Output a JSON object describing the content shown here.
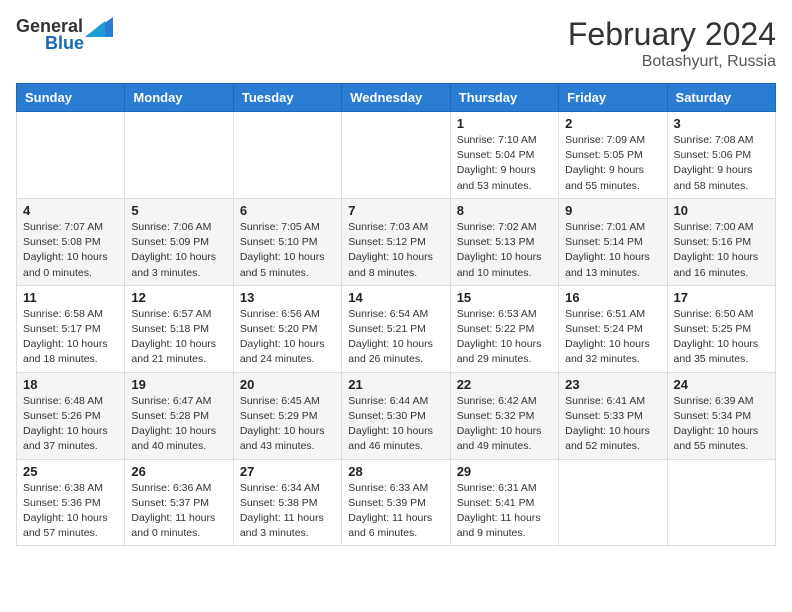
{
  "header": {
    "logo": {
      "general": "General",
      "blue": "Blue"
    },
    "title": "February 2024",
    "location": "Botashyurt, Russia"
  },
  "days_of_week": [
    "Sunday",
    "Monday",
    "Tuesday",
    "Wednesday",
    "Thursday",
    "Friday",
    "Saturday"
  ],
  "weeks": [
    [
      {
        "day": "",
        "info": ""
      },
      {
        "day": "",
        "info": ""
      },
      {
        "day": "",
        "info": ""
      },
      {
        "day": "",
        "info": ""
      },
      {
        "day": "1",
        "info": "Sunrise: 7:10 AM\nSunset: 5:04 PM\nDaylight: 9 hours\nand 53 minutes."
      },
      {
        "day": "2",
        "info": "Sunrise: 7:09 AM\nSunset: 5:05 PM\nDaylight: 9 hours\nand 55 minutes."
      },
      {
        "day": "3",
        "info": "Sunrise: 7:08 AM\nSunset: 5:06 PM\nDaylight: 9 hours\nand 58 minutes."
      }
    ],
    [
      {
        "day": "4",
        "info": "Sunrise: 7:07 AM\nSunset: 5:08 PM\nDaylight: 10 hours\nand 0 minutes."
      },
      {
        "day": "5",
        "info": "Sunrise: 7:06 AM\nSunset: 5:09 PM\nDaylight: 10 hours\nand 3 minutes."
      },
      {
        "day": "6",
        "info": "Sunrise: 7:05 AM\nSunset: 5:10 PM\nDaylight: 10 hours\nand 5 minutes."
      },
      {
        "day": "7",
        "info": "Sunrise: 7:03 AM\nSunset: 5:12 PM\nDaylight: 10 hours\nand 8 minutes."
      },
      {
        "day": "8",
        "info": "Sunrise: 7:02 AM\nSunset: 5:13 PM\nDaylight: 10 hours\nand 10 minutes."
      },
      {
        "day": "9",
        "info": "Sunrise: 7:01 AM\nSunset: 5:14 PM\nDaylight: 10 hours\nand 13 minutes."
      },
      {
        "day": "10",
        "info": "Sunrise: 7:00 AM\nSunset: 5:16 PM\nDaylight: 10 hours\nand 16 minutes."
      }
    ],
    [
      {
        "day": "11",
        "info": "Sunrise: 6:58 AM\nSunset: 5:17 PM\nDaylight: 10 hours\nand 18 minutes."
      },
      {
        "day": "12",
        "info": "Sunrise: 6:57 AM\nSunset: 5:18 PM\nDaylight: 10 hours\nand 21 minutes."
      },
      {
        "day": "13",
        "info": "Sunrise: 6:56 AM\nSunset: 5:20 PM\nDaylight: 10 hours\nand 24 minutes."
      },
      {
        "day": "14",
        "info": "Sunrise: 6:54 AM\nSunset: 5:21 PM\nDaylight: 10 hours\nand 26 minutes."
      },
      {
        "day": "15",
        "info": "Sunrise: 6:53 AM\nSunset: 5:22 PM\nDaylight: 10 hours\nand 29 minutes."
      },
      {
        "day": "16",
        "info": "Sunrise: 6:51 AM\nSunset: 5:24 PM\nDaylight: 10 hours\nand 32 minutes."
      },
      {
        "day": "17",
        "info": "Sunrise: 6:50 AM\nSunset: 5:25 PM\nDaylight: 10 hours\nand 35 minutes."
      }
    ],
    [
      {
        "day": "18",
        "info": "Sunrise: 6:48 AM\nSunset: 5:26 PM\nDaylight: 10 hours\nand 37 minutes."
      },
      {
        "day": "19",
        "info": "Sunrise: 6:47 AM\nSunset: 5:28 PM\nDaylight: 10 hours\nand 40 minutes."
      },
      {
        "day": "20",
        "info": "Sunrise: 6:45 AM\nSunset: 5:29 PM\nDaylight: 10 hours\nand 43 minutes."
      },
      {
        "day": "21",
        "info": "Sunrise: 6:44 AM\nSunset: 5:30 PM\nDaylight: 10 hours\nand 46 minutes."
      },
      {
        "day": "22",
        "info": "Sunrise: 6:42 AM\nSunset: 5:32 PM\nDaylight: 10 hours\nand 49 minutes."
      },
      {
        "day": "23",
        "info": "Sunrise: 6:41 AM\nSunset: 5:33 PM\nDaylight: 10 hours\nand 52 minutes."
      },
      {
        "day": "24",
        "info": "Sunrise: 6:39 AM\nSunset: 5:34 PM\nDaylight: 10 hours\nand 55 minutes."
      }
    ],
    [
      {
        "day": "25",
        "info": "Sunrise: 6:38 AM\nSunset: 5:36 PM\nDaylight: 10 hours\nand 57 minutes."
      },
      {
        "day": "26",
        "info": "Sunrise: 6:36 AM\nSunset: 5:37 PM\nDaylight: 11 hours\nand 0 minutes."
      },
      {
        "day": "27",
        "info": "Sunrise: 6:34 AM\nSunset: 5:38 PM\nDaylight: 11 hours\nand 3 minutes."
      },
      {
        "day": "28",
        "info": "Sunrise: 6:33 AM\nSunset: 5:39 PM\nDaylight: 11 hours\nand 6 minutes."
      },
      {
        "day": "29",
        "info": "Sunrise: 6:31 AM\nSunset: 5:41 PM\nDaylight: 11 hours\nand 9 minutes."
      },
      {
        "day": "",
        "info": ""
      },
      {
        "day": "",
        "info": ""
      }
    ]
  ]
}
